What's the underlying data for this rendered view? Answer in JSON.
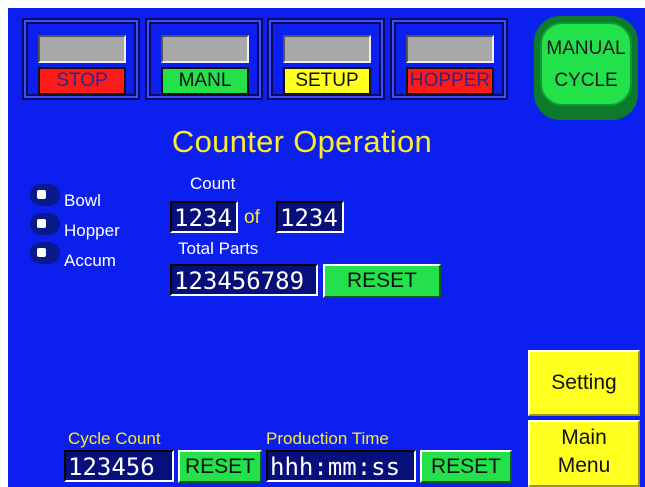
{
  "status": [
    {
      "label": "STOP",
      "bg": "#ff1a1a",
      "fg": "#2a2a8a"
    },
    {
      "label": "MANL",
      "bg": "#22e14a",
      "fg": "#111111"
    },
    {
      "label": "SETUP",
      "bg": "#ffff20",
      "fg": "#111111"
    },
    {
      "label": "HOPPER",
      "bg": "#ff1a1a",
      "fg": "#2a2a8a"
    }
  ],
  "manual_cycle": {
    "line1": "MANUAL",
    "line2": "CYCLE"
  },
  "title": "Counter Operation",
  "indicators": [
    {
      "label": "Bowl"
    },
    {
      "label": "Hopper"
    },
    {
      "label": "Accum"
    }
  ],
  "count": {
    "label": "Count",
    "current": "1234",
    "of_label": "of",
    "target": "1234"
  },
  "total_parts": {
    "label": "Total Parts",
    "value": "123456789",
    "reset_label": "RESET"
  },
  "cycle_count": {
    "label": "Cycle Count",
    "value": "123456",
    "reset_label": "RESET"
  },
  "production_time": {
    "label": "Production Time",
    "value": "hhh:mm:ss",
    "reset_label": "RESET"
  },
  "nav": {
    "setting_label": "Setting",
    "main_menu_line1": "Main",
    "main_menu_line2": "Menu"
  },
  "colors": {
    "screen_bg": "#0b1fee",
    "title": "#ffea30",
    "green": "#22e14a",
    "yellow": "#ffff20",
    "red": "#ff1a1a"
  }
}
